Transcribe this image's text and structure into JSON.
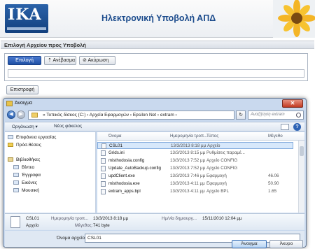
{
  "header": {
    "logo_text": "IKA",
    "title": "Ηλεκτρονική Υποβολή ΑΠΔ"
  },
  "section": {
    "title": "Επιλογή Αρχείου προς Υποβολή"
  },
  "form": {
    "select_label": "Επιλογή",
    "upload_label": "Ανέβασμα",
    "cancel_label": "Ακύρωση",
    "back_label": "Επιστροφή"
  },
  "dialog": {
    "title": "Άνοιγμα",
    "address": "«  Τοπικός δίσκος (C:)  ›  Αρχεία Εφαρμογών  ›  Epsilon Net  ›  extram  ›",
    "search_placeholder": "Αναζήτηση extram",
    "toolbar": {
      "organize": "Οργάνωση ▾",
      "new_folder": "Νέος φάκελος"
    },
    "nav_items": [
      {
        "label": "Επιφάνεια εργασίας",
        "icon": "desktop-icon"
      },
      {
        "label": "Πρόσ.θέσεις",
        "icon": "recent-places-icon"
      },
      {
        "label": "Βιβλιοθήκες",
        "icon": "libraries-icon"
      },
      {
        "label": "Βίντεο",
        "icon": "videos-icon"
      },
      {
        "label": "Έγγραφα",
        "icon": "documents-icon"
      },
      {
        "label": "Εικόνες",
        "icon": "pictures-icon"
      },
      {
        "label": "Μουσική",
        "icon": "music-icon"
      }
    ],
    "columns": {
      "name": "Όνομα",
      "date": "Ημερομηνία τροπ...",
      "type": "Τύπος",
      "size": "Μέγεθο"
    },
    "files": [
      {
        "name": "CSL01",
        "date": "13/3/2013 8:18 μμ",
        "type": "Αρχείο",
        "size": ""
      },
      {
        "name": "Grids.ini",
        "date": "13/3/2013 8:15 μμ",
        "type": "Ρυθμίσεις παραμέ...",
        "size": ""
      },
      {
        "name": "misthodosia.config",
        "date": "13/3/2013 7:52 μμ",
        "type": "Αρχείο CONFIG",
        "size": ""
      },
      {
        "name": "Update_AutoBackup.config",
        "date": "13/3/2013 7:52 μμ",
        "type": "Αρχείο CONFIG",
        "size": ""
      },
      {
        "name": "updClient.exe",
        "date": "13/3/2013 7:46 μμ",
        "type": "Εφαρμογή",
        "size": "46.06"
      },
      {
        "name": "misthodosia.exe",
        "date": "13/3/2013 4:11 μμ",
        "type": "Εφαρμογή",
        "size": "50.90"
      },
      {
        "name": "extram_apps.bpl",
        "date": "13/3/2013 4:11 μμ",
        "type": "Αρχείο BPL",
        "size": "1.65"
      }
    ],
    "details": {
      "name": "CSL01",
      "type": "Αρχείο",
      "modified_label": "Ημερομηνία τροπ...",
      "modified": "13/3/2013 8:18 μμ",
      "size_label": "Μέγεθος:",
      "size": "741 byte",
      "created_label": "Ημ/νία δημιουργ...",
      "created": "15/11/2010 12:04 μμ"
    },
    "filename_label": "Όνομα αρχείου:",
    "filename_value": "CSL01",
    "open_label": "Άνοιγμα",
    "cancel_label": "Άκυρο"
  },
  "colors": {
    "brand_blue": "#1b4b8c",
    "selected_row": "#d7e8fb"
  }
}
